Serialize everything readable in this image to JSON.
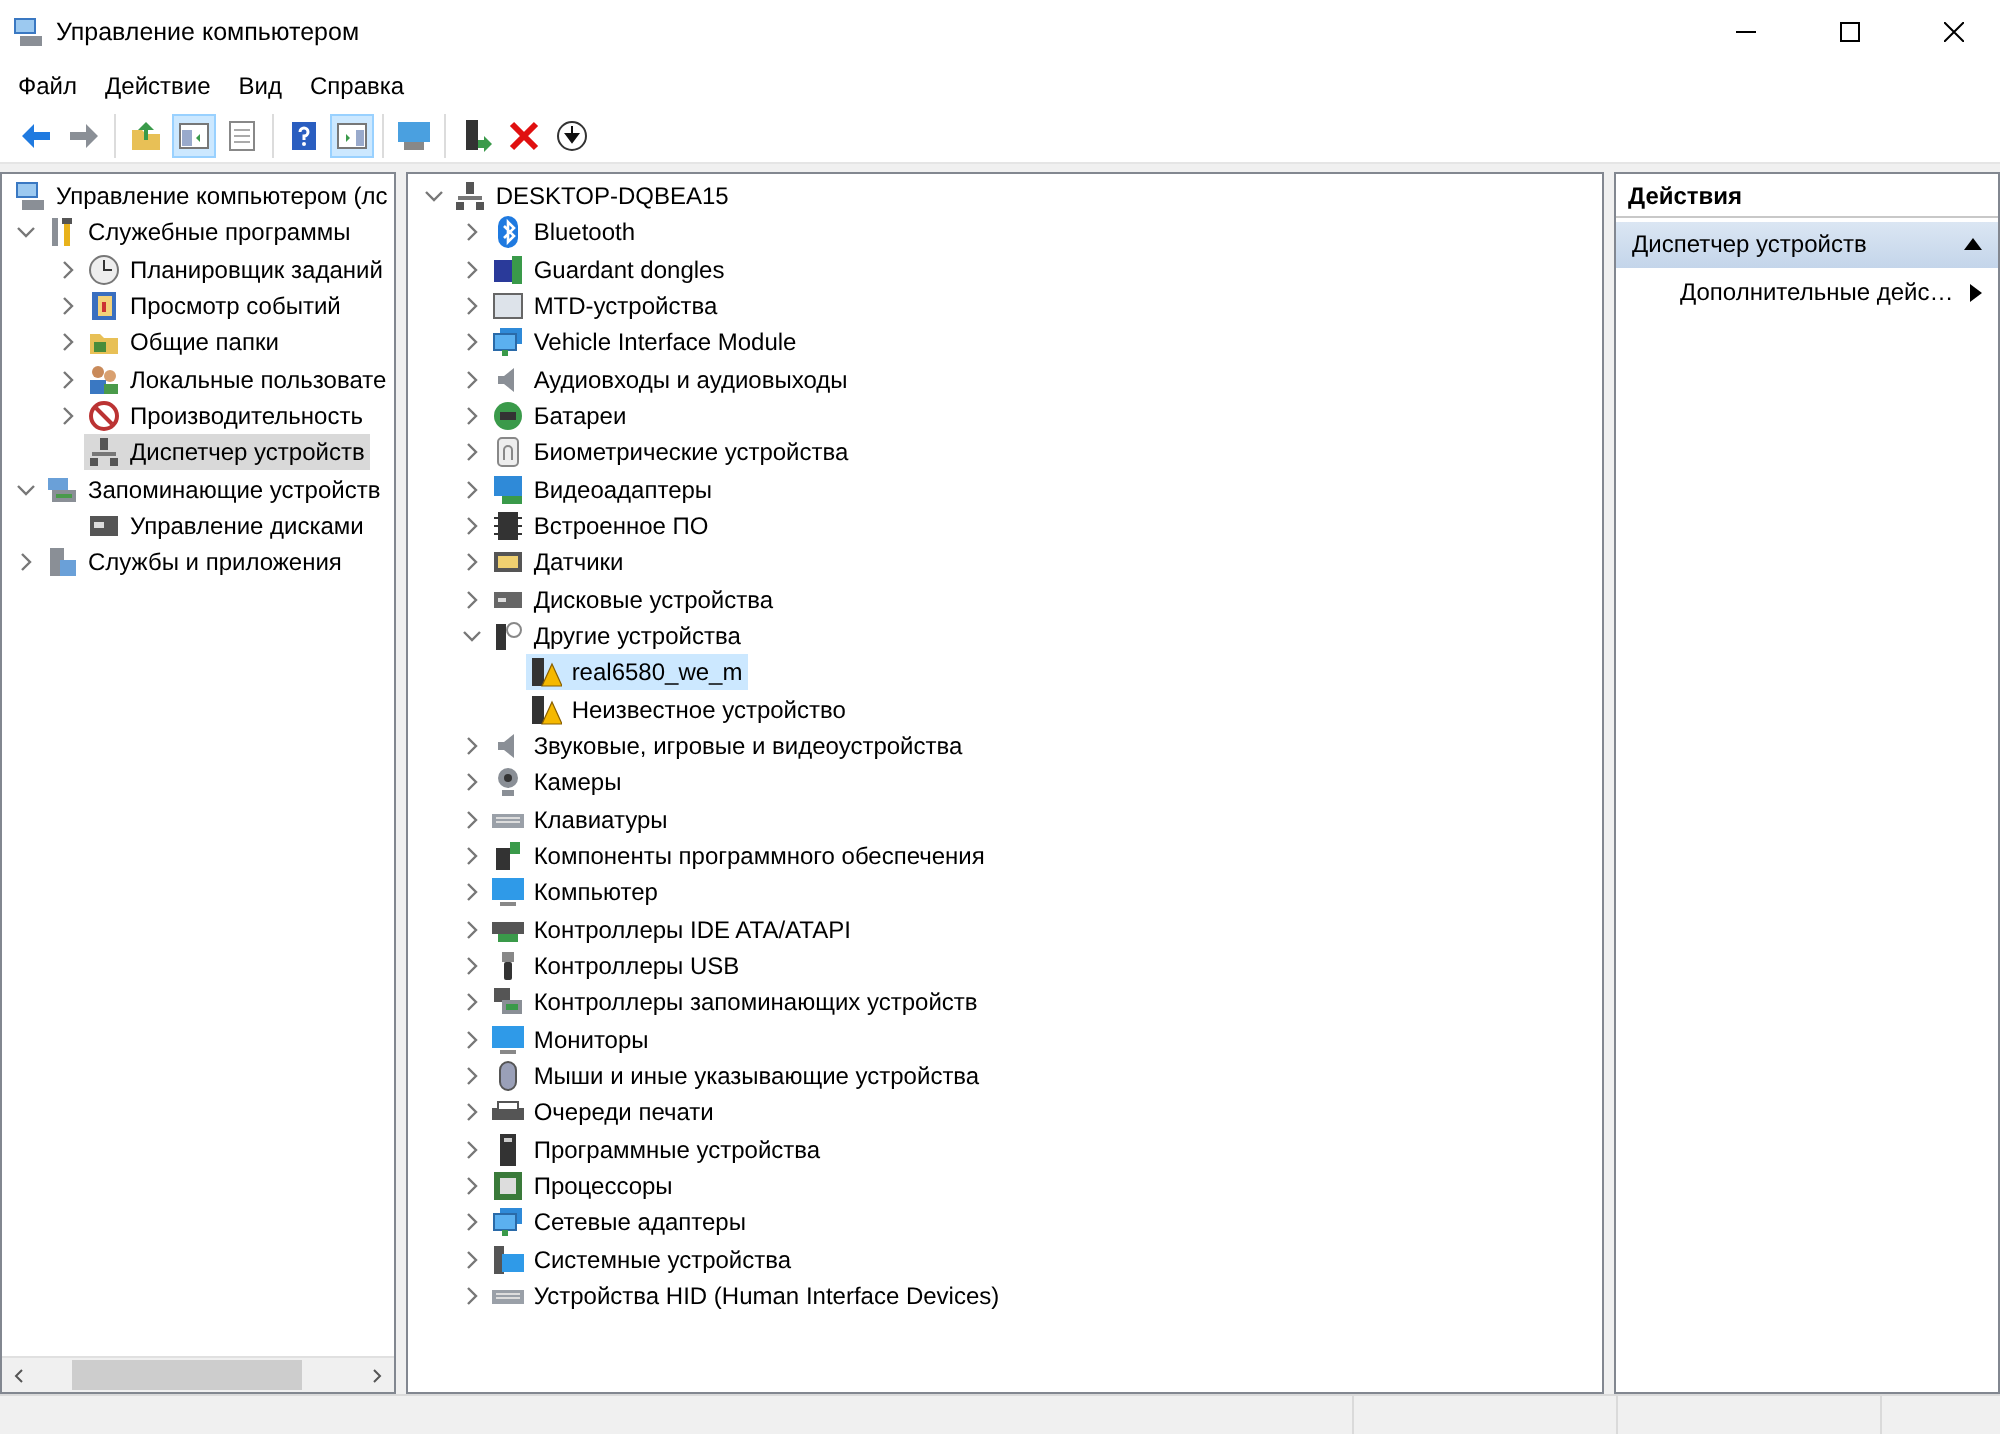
{
  "window": {
    "title": "Управление компьютером"
  },
  "menu": [
    {
      "label": "Файл"
    },
    {
      "label": "Действие"
    },
    {
      "label": "Вид"
    },
    {
      "label": "Справка"
    }
  ],
  "toolbar": [
    [
      {
        "kind": "back",
        "pressed": false
      },
      {
        "kind": "forward",
        "pressed": false
      }
    ],
    [
      {
        "kind": "up",
        "pressed": false
      },
      {
        "kind": "tree",
        "pressed": true
      },
      {
        "kind": "props",
        "pressed": false
      }
    ],
    [
      {
        "kind": "help",
        "pressed": false
      },
      {
        "kind": "actionpane",
        "pressed": true
      }
    ],
    [
      {
        "kind": "screen",
        "pressed": false
      }
    ],
    [
      {
        "kind": "enable",
        "pressed": false
      },
      {
        "kind": "uninstall",
        "pressed": false
      },
      {
        "kind": "update",
        "pressed": false
      }
    ]
  ],
  "left_tree": [
    {
      "label": "Управление компьютером (лс",
      "kind": "mgmt",
      "selected": false,
      "children": [
        {
          "label": "Служебные программы",
          "kind": "tools",
          "expanded": true,
          "selected": false,
          "children": [
            {
              "label": "Планировщик заданий",
              "kind": "clock",
              "expanded": false,
              "selected": false
            },
            {
              "label": "Просмотр событий",
              "kind": "log",
              "expanded": false,
              "selected": false
            },
            {
              "label": "Общие папки",
              "kind": "folder",
              "expanded": false,
              "selected": false
            },
            {
              "label": "Локальные пользовате",
              "kind": "users",
              "expanded": false,
              "selected": false
            },
            {
              "label": "Производительность",
              "kind": "perf",
              "expanded": false,
              "selected": false
            },
            {
              "label": "Диспетчер устройств",
              "kind": "devmgr",
              "selected": true
            }
          ]
        },
        {
          "label": "Запоминающие устройств",
          "kind": "storage",
          "expanded": true,
          "selected": false,
          "children": [
            {
              "label": "Управление дисками",
              "kind": "diskmgmt",
              "selected": false
            }
          ]
        },
        {
          "label": "Службы и приложения",
          "kind": "services",
          "expanded": false,
          "selected": false
        }
      ]
    }
  ],
  "device_tree": [
    {
      "label": "DESKTOP-DQBEA15",
      "kind": "devmgr",
      "expanded": true,
      "selected": false,
      "children": [
        {
          "label": "Bluetooth",
          "kind": "bluetooth",
          "expanded": false,
          "selected": false
        },
        {
          "label": "Guardant dongles",
          "kind": "dongle",
          "expanded": false,
          "selected": false
        },
        {
          "label": "MTD-устройства",
          "kind": "mtd",
          "expanded": false,
          "selected": false
        },
        {
          "label": "Vehicle Interface Module",
          "kind": "netmon",
          "expanded": false,
          "selected": false
        },
        {
          "label": "Аудиовходы и аудиовыходы",
          "kind": "speaker",
          "expanded": false,
          "selected": false
        },
        {
          "label": "Батареи",
          "kind": "battery",
          "expanded": false,
          "selected": false
        },
        {
          "label": "Биометрические устройства",
          "kind": "finger",
          "expanded": false,
          "selected": false
        },
        {
          "label": "Видеоадаптеры",
          "kind": "video",
          "expanded": false,
          "selected": false
        },
        {
          "label": "Встроенное ПО",
          "kind": "chip",
          "expanded": false,
          "selected": false
        },
        {
          "label": "Датчики",
          "kind": "sensor",
          "expanded": false,
          "selected": false
        },
        {
          "label": "Дисковые устройства",
          "kind": "disk",
          "expanded": false,
          "selected": false
        },
        {
          "label": "Другие устройства",
          "kind": "other",
          "expanded": true,
          "selected": false,
          "children": [
            {
              "label": "real6580_we_m",
              "kind": "warning",
              "selected": true
            },
            {
              "label": "Неизвестное устройство",
              "kind": "warning",
              "selected": false
            }
          ]
        },
        {
          "label": "Звуковые, игровые и видеоустройства",
          "kind": "speaker",
          "expanded": false,
          "selected": false
        },
        {
          "label": "Камеры",
          "kind": "camera",
          "expanded": false,
          "selected": false
        },
        {
          "label": "Клавиатуры",
          "kind": "keyboard",
          "expanded": false,
          "selected": false
        },
        {
          "label": "Компоненты программного обеспечения",
          "kind": "component",
          "expanded": false,
          "selected": false
        },
        {
          "label": "Компьютер",
          "kind": "monitor",
          "expanded": false,
          "selected": false
        },
        {
          "label": "Контроллеры IDE ATA/ATAPI",
          "kind": "card",
          "expanded": false,
          "selected": false
        },
        {
          "label": "Контроллеры USB",
          "kind": "usb",
          "expanded": false,
          "selected": false
        },
        {
          "label": "Контроллеры запоминающих устройств",
          "kind": "storctl",
          "expanded": false,
          "selected": false
        },
        {
          "label": "Мониторы",
          "kind": "monitor",
          "expanded": false,
          "selected": false
        },
        {
          "label": "Мыши и иные указывающие устройства",
          "kind": "mouse",
          "expanded": false,
          "selected": false
        },
        {
          "label": "Очереди печати",
          "kind": "printer",
          "expanded": false,
          "selected": false
        },
        {
          "label": "Программные устройства",
          "kind": "tower",
          "expanded": false,
          "selected": false
        },
        {
          "label": "Процессоры",
          "kind": "cpu",
          "expanded": false,
          "selected": false
        },
        {
          "label": "Сетевые адаптеры",
          "kind": "netmon",
          "expanded": false,
          "selected": false
        },
        {
          "label": "Системные устройства",
          "kind": "sysfolder",
          "expanded": false,
          "selected": false
        },
        {
          "label": "Устройства HID (Human Interface Devices)",
          "kind": "keyboard",
          "expanded": false,
          "selected": false
        }
      ]
    }
  ],
  "actions": {
    "header": "Действия",
    "sections": [
      {
        "title": "Диспетчер устройств",
        "expanded": true,
        "items": [
          {
            "label": "Дополнительные дейс…",
            "submenu": true
          }
        ]
      }
    ]
  }
}
